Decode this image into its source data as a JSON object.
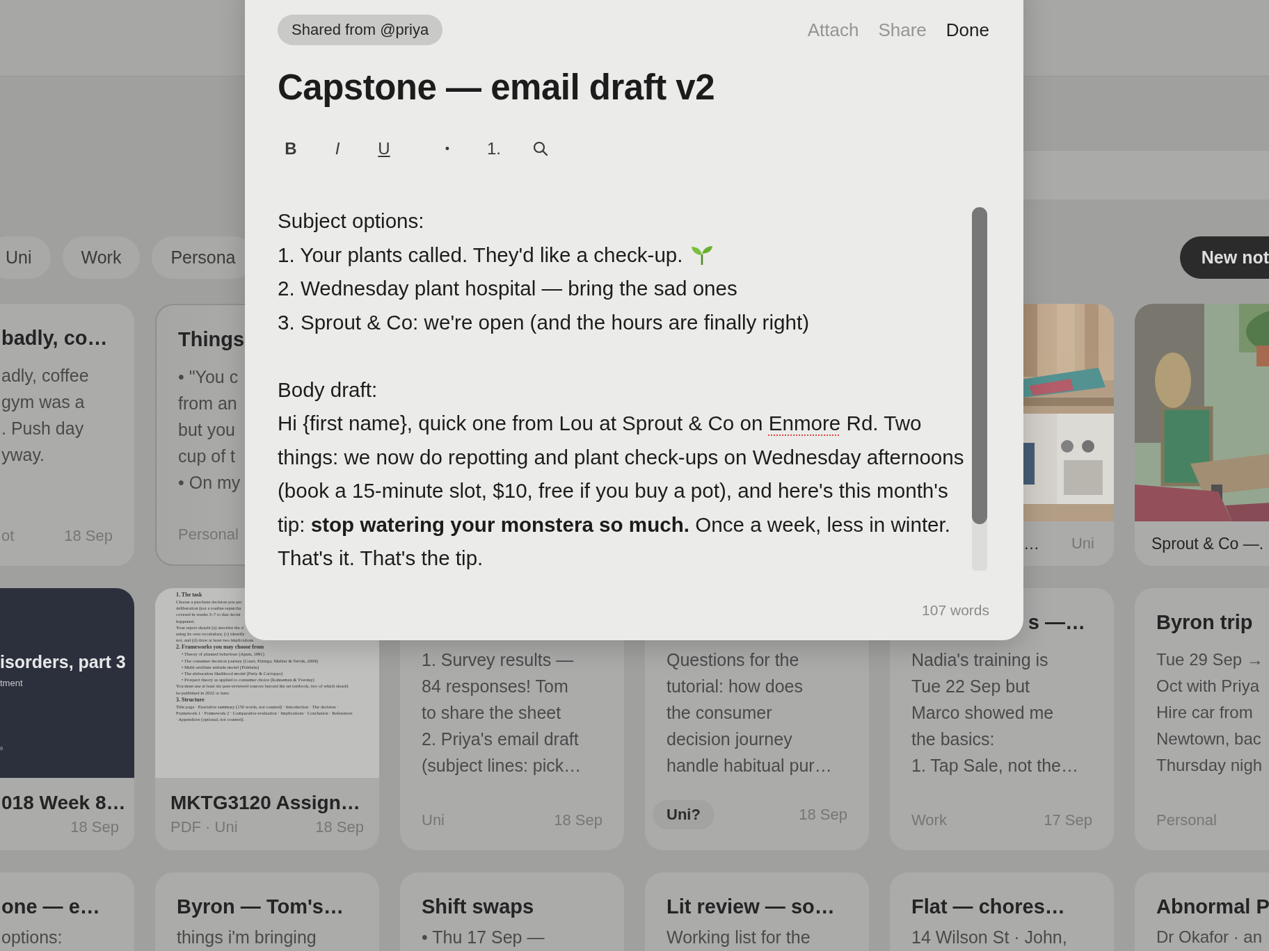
{
  "filters": [
    {
      "label": "Uni",
      "selected": false
    },
    {
      "label": "Work",
      "selected": false
    },
    {
      "label": "Persona",
      "selected": false
    }
  ],
  "new_note_button": "New not",
  "note_rows": [
    {
      "cards": [
        {
          "kind": "text",
          "title": "badly, co…",
          "lines": [
            "adly, coffee",
            "gym was a",
            ". Push day",
            "yway."
          ],
          "tag": "ot",
          "tag_suggested": false,
          "date": "18 Sep",
          "selected": false
        },
        {
          "kind": "text",
          "title": "Things",
          "lines": [
            "• \"You c",
            "from an",
            "but you",
            "cup of t",
            "• On my"
          ],
          "tag": "Personal",
          "tag_suggested": false,
          "selected": true
        },
        {
          "caption": "…",
          "tag": "Uni",
          "tag_suggested": false,
          "selected": false
        },
        {
          "caption": "Sprout & Co —.",
          "selected": false
        }
      ]
    },
    {
      "cards": [
        {
          "kind": "slide",
          "slide_title": "isorders, part 3",
          "slide_subtitle": "tment",
          "slide_footer": "6",
          "title": "018 Week 8…",
          "date": "18 Sep",
          "selected": false
        },
        {
          "kind": "pdf",
          "title": "MKTG3120 Assign…",
          "tag": "PDF · Uni",
          "tag_suggested": false,
          "date": "18 Sep",
          "selected": false,
          "preview": [
            {
              "kind": "heading",
              "text": "1. The task"
            },
            {
              "kind": "text",
              "text": "Choose a purchase decision you per"
            },
            {
              "kind": "text",
              "text": "deliberation (not a routine repurcha"
            },
            {
              "kind": "text",
              "text": "covered in weeks 3–7 to that decisi"
            },
            {
              "kind": "text",
              "text": "happened."
            },
            {
              "kind": "text",
              "text": "Your report should (a) describe the d"
            },
            {
              "kind": "text",
              "text": "using its own vocabulary, (c) identify"
            },
            {
              "kind": "text",
              "text": "not, and (d) draw at least two implications"
            },
            {
              "kind": "heading",
              "text": "2. Frameworks you may choose from"
            },
            {
              "kind": "bullet",
              "text": "• Theory of planned behaviour (Ajzen, 1991)"
            },
            {
              "kind": "bullet",
              "text": "• The consumer decision journey (Court, Elzinga, Mulder & Vetvik, 2009)"
            },
            {
              "kind": "bullet",
              "text": "• Multi-attribute attitude model (Fishbein)"
            },
            {
              "kind": "bullet",
              "text": "• The elaboration likelihood model (Petty & Cacioppo)"
            },
            {
              "kind": "bullet",
              "text": "• Prospect theory as applied to consumer choice (Kahneman & Tversky)"
            },
            {
              "kind": "text",
              "text": "You must use at least six peer-reviewed sources beyond the set textbook, two of which should be published in 2022 or later."
            },
            {
              "kind": "heading",
              "text": "3. Structure"
            },
            {
              "kind": "text",
              "text": "Title page · Executive summary (150 words, not counted) · Introduction · The decision · Framework 1 · Framework 2 · Comparative evaluation · Implications · Conclusion · References · Appendices (optional, not counted)."
            }
          ]
        },
        {
          "kind": "text",
          "lines": [
            "1. Survey results —",
            "84 responses! Tom",
            "to share the sheet",
            "2. Priya's email draft",
            "(subject lines: pick…"
          ],
          "tag": "Uni",
          "tag_suggested": false,
          "date": "18 Sep",
          "selected": false
        },
        {
          "kind": "text",
          "lines": [
            "Questions for the",
            "tutorial: how does",
            "the consumer",
            "decision journey",
            "handle habitual pur…"
          ],
          "tag": "Uni?",
          "tag_suggested": true,
          "date": "18 Sep",
          "selected": false
        },
        {
          "kind": "text",
          "title": "s —…",
          "lines": [
            "Nadia's training is",
            "Tue 22 Sep but",
            "Marco showed me",
            "the basics:",
            "1. Tap Sale, not the…"
          ],
          "tag": "Work",
          "tag_suggested": false,
          "date": "17 Sep",
          "selected": false
        },
        {
          "kind": "text",
          "title": "Byron trip",
          "lines": [
            "Tue 29 Sep →",
            "Oct with Priya",
            "Hire car from",
            "Newtown, bac",
            "Thursday nigh"
          ],
          "tag": "Personal",
          "tag_suggested": false,
          "selected": false
        }
      ]
    },
    {
      "cards": [
        {
          "kind": "text",
          "title": "one — e…",
          "lines": [
            "options:"
          ],
          "selected": false
        },
        {
          "kind": "text",
          "title": "Byron — Tom's…",
          "lines": [
            "things i'm bringing"
          ],
          "selected": false
        },
        {
          "kind": "text",
          "title": "Shift swaps",
          "lines": [
            "• Thu 17 Sep —"
          ],
          "selected": false
        },
        {
          "kind": "text",
          "title": "Lit review — so…",
          "lines": [
            "Working list for the"
          ],
          "selected": false
        },
        {
          "kind": "text",
          "title": "Flat — chores…",
          "lines": [
            "14 Wilson St · John,"
          ],
          "selected": false
        },
        {
          "kind": "text",
          "title": "Abnormal P",
          "lines": [
            "Dr Okafor · an"
          ],
          "selected": false
        }
      ]
    }
  ],
  "editor": {
    "shared_badge": "Shared from @priya",
    "actions": [
      {
        "label": "Attach",
        "kind": "secondary"
      },
      {
        "label": "Share",
        "kind": "secondary"
      },
      {
        "label": "Done",
        "kind": "primary"
      }
    ],
    "title": "Capstone — email draft v2",
    "toolbar": [
      {
        "kind": "bold",
        "label": "B"
      },
      {
        "kind": "italic",
        "label": "I"
      },
      {
        "kind": "underline",
        "label": "U"
      },
      {
        "kind": "bullet",
        "label": "•"
      },
      {
        "kind": "numbered",
        "label": "1."
      },
      {
        "kind": "search"
      }
    ],
    "subject_heading": "Subject options:",
    "subject_lines": [
      {
        "text": "1. Your plants called. They'd like a check-up.",
        "trailing_icon": true
      },
      {
        "text": "2. Wednesday plant hospital — bring the sad ones",
        "trailing_icon": false
      },
      {
        "text": "3. Sprout & Co: we're open (and the hours are finally right)",
        "trailing_icon": false
      }
    ],
    "body_heading": "Body draft:",
    "body_segments": [
      {
        "text": "Hi {first name}, quick one from Lou at Sprout & Co on ",
        "misspelled": false
      },
      {
        "text": "Enmore",
        "misspelled": true
      },
      {
        "text": " Rd. Two things: we now do repotting and plant check-ups on Wednesday afternoons (book a 15-minute slot, $10, free if you buy a pot), and here's this month's tip: **stop watering your monstera so much.** Once a week, less in winter. That's it. That's the tip.",
        "misspelled": false
      }
    ],
    "word_count": "107 words"
  }
}
